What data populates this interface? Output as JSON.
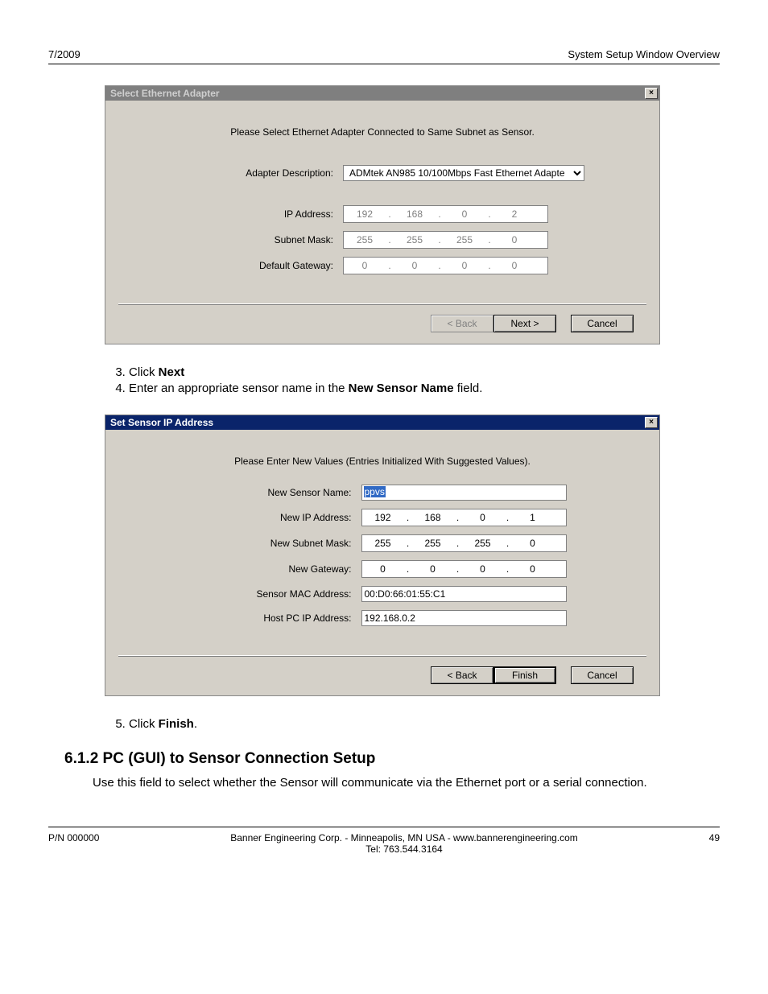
{
  "header": {
    "left": "7/2009",
    "right": "System Setup Window Overview"
  },
  "dlg1": {
    "title": "Select Ethernet Adapter",
    "close_glyph": "×",
    "prompt": "Please Select Ethernet Adapter Connected to Same Subnet as Sensor.",
    "labels": {
      "adapter": "Adapter Description:",
      "ip": "IP Address:",
      "subnet": "Subnet Mask:",
      "gateway": "Default Gateway:"
    },
    "adapter_value": "ADMtek AN985 10/100Mbps Fast Ethernet Adapte",
    "ip": [
      "192",
      "168",
      "0",
      "2"
    ],
    "subnet": [
      "255",
      "255",
      "255",
      "0"
    ],
    "gateway": [
      "0",
      "0",
      "0",
      "0"
    ],
    "buttons": {
      "back": "< Back",
      "next": "Next >",
      "cancel": "Cancel"
    }
  },
  "steps_a": [
    {
      "n": "3.",
      "pre": "Click ",
      "b": "Next",
      "post": ""
    },
    {
      "n": "4.",
      "pre": "Enter an appropriate sensor name in the ",
      "b": "New Sensor Name",
      "post": " field."
    }
  ],
  "dlg2": {
    "title": "Set Sensor IP Address",
    "close_glyph": "×",
    "prompt": "Please Enter New Values (Entries Initialized With Suggested Values).",
    "labels": {
      "name": "New Sensor Name:",
      "ip": "New IP Address:",
      "subnet": "New Subnet Mask:",
      "gateway": "New Gateway:",
      "mac": "Sensor MAC Address:",
      "host": "Host PC IP Address:"
    },
    "name_value": "ppvs",
    "ip": [
      "192",
      "168",
      "0",
      "1"
    ],
    "subnet": [
      "255",
      "255",
      "255",
      "0"
    ],
    "gateway": [
      "0",
      "0",
      "0",
      "0"
    ],
    "mac": "00:D0:66:01:55:C1",
    "host": "192.168.0.2",
    "buttons": {
      "back": "< Back",
      "finish": "Finish",
      "cancel": "Cancel"
    }
  },
  "steps_b": [
    {
      "n": "5.",
      "pre": "Click ",
      "b": "Finish",
      "post": "."
    }
  ],
  "section_heading": "6.1.2 PC (GUI) to Sensor Connection Setup",
  "section_body": "Use this field to select whether the Sensor will communicate via the Ethernet port or a serial connection.",
  "footer": {
    "left": "P/N 000000",
    "center1": "Banner Engineering Corp. - Minneapolis, MN USA - www.bannerengineering.com",
    "center2": "Tel: 763.544.3164",
    "right": "49"
  }
}
